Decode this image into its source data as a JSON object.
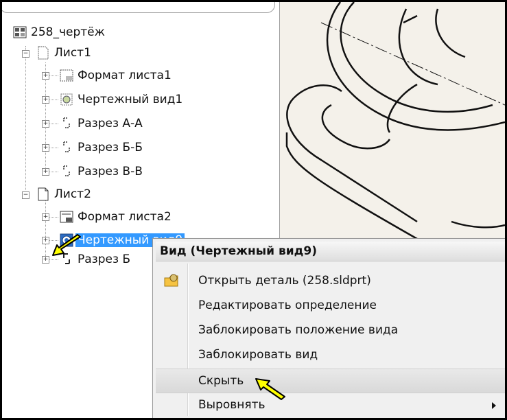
{
  "tree": {
    "root_label": "258_чертёж",
    "items": [
      {
        "label": "Лист1"
      },
      {
        "label": "Формат листа1"
      },
      {
        "label": "Чертежный вид1"
      },
      {
        "label": "Разрез А-А"
      },
      {
        "label": "Разрез Б-Б"
      },
      {
        "label": "Разрез В-В"
      },
      {
        "label": "Лист2"
      },
      {
        "label": "Формат листа2"
      },
      {
        "label": "Чертежный вид9"
      },
      {
        "label": "Разрез Б"
      }
    ]
  },
  "context_menu": {
    "title": "Вид (Чертежный вид9)",
    "items": [
      {
        "label": "Открыть деталь (258.sldprt)",
        "icon": "open-part-icon"
      },
      {
        "label": "Редактировать определение"
      },
      {
        "label": "Заблокировать положение вида"
      },
      {
        "label": "Заблокировать вид"
      },
      {
        "label": "Скрыть",
        "highlighted": true
      },
      {
        "label": "Выровнять",
        "has_submenu": true
      }
    ]
  },
  "colors": {
    "selection": "#3399ff",
    "annotation_arrow": "#ffff00",
    "canvas": "#f4f1ea"
  }
}
